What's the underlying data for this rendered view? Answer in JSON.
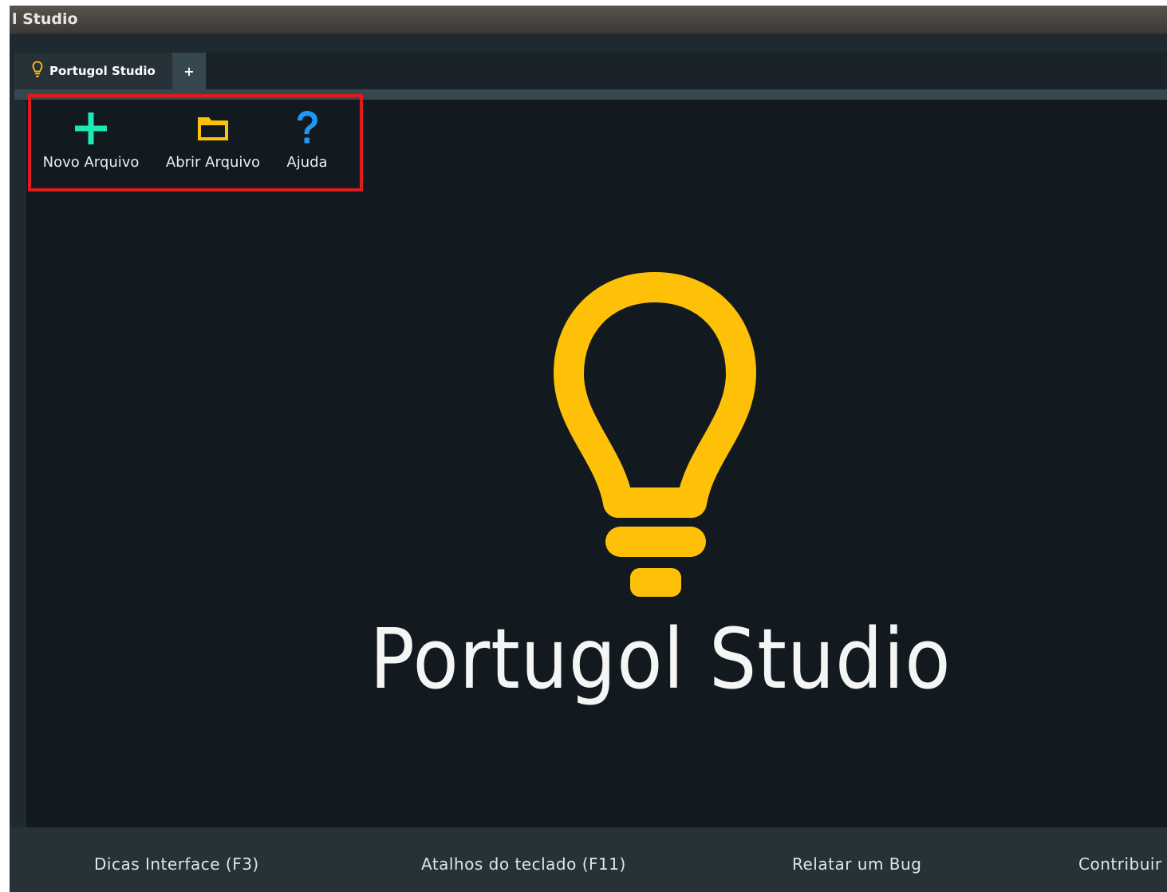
{
  "window": {
    "title": "l Studio"
  },
  "tabs": [
    {
      "label": "Portugol Studio",
      "icon": "lightbulb-icon"
    },
    {
      "label": "+",
      "icon": "plus-icon"
    }
  ],
  "toolbar": {
    "new_file": {
      "label": "Novo Arquivo",
      "icon": "plus-icon",
      "color": "#1de9b6"
    },
    "open_file": {
      "label": "Abrir Arquivo",
      "icon": "folder-icon",
      "color": "#ffc107"
    },
    "help": {
      "label": "Ajuda",
      "icon": "question-icon",
      "color": "#2196f3"
    }
  },
  "logo": {
    "text": "Portugol Studio",
    "icon": "lightbulb-icon",
    "color": "#ffc107"
  },
  "footer": {
    "tips": "Dicas Interface (F3)",
    "shortcuts": "Atalhos do teclado (F11)",
    "bug": "Relatar um Bug",
    "contribute": "Contribuir"
  },
  "colors": {
    "highlight": "#e01b1b",
    "background": "#121a20",
    "panel": "#263238"
  }
}
